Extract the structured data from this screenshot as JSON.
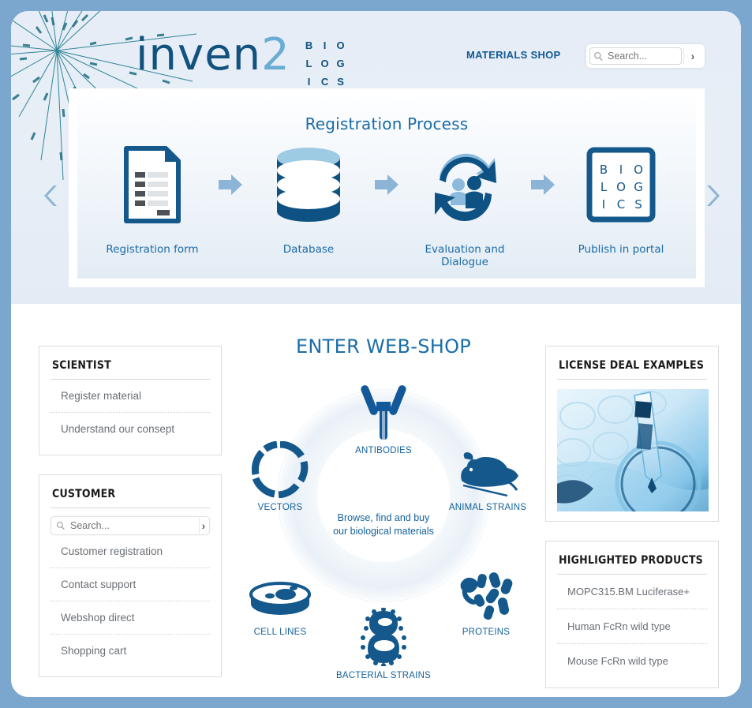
{
  "brand": {
    "word": "inven",
    "word_accent": "2",
    "grid": [
      "B",
      "I",
      "O",
      "L",
      "O",
      "G",
      "I",
      "C",
      "S"
    ]
  },
  "header": {
    "materials_shop": "MATERIALS SHOP",
    "search_placeholder": "Search...",
    "search_value": "",
    "search_icon": "search-icon",
    "go_icon": "chevron-right-icon"
  },
  "banner": {
    "title": "Registration Process",
    "prev_icon": "chevron-left-icon",
    "next_icon": "chevron-right-icon",
    "steps": [
      {
        "label": "Registration form",
        "icon": "document-icon"
      },
      {
        "label": "Database",
        "icon": "database-cylinder-icon"
      },
      {
        "label": "Evaluation and Dialogue",
        "icon": "dialogue-cycle-icon"
      },
      {
        "label": "Publish in portal",
        "icon": "biologics-box-icon"
      }
    ],
    "arrow_icon": "arrow-right-icon",
    "publish_grid": [
      "B",
      "I",
      "O",
      "L",
      "O",
      "G",
      "I",
      "C",
      "S"
    ]
  },
  "sidebar": {
    "scientist": {
      "heading": "SCIENTIST",
      "items": [
        "Register material",
        "Understand our consept"
      ]
    },
    "customer": {
      "heading": "CUSTOMER",
      "search_placeholder": "Search...",
      "search_value": "",
      "items": [
        "Customer registration",
        "Contact support",
        "Webshop direct",
        "Shopping cart"
      ]
    }
  },
  "webshop": {
    "title": "ENTER WEB-SHOP",
    "center_line1": "Browse, find and buy",
    "center_line2": "our biological materials",
    "nodes": [
      {
        "label": "ANTIBODIES",
        "icon": "antibody-icon"
      },
      {
        "label": "ANIMAL STRAINS",
        "icon": "mouse-icon"
      },
      {
        "label": "PROTEINS",
        "icon": "protein-ribbon-icon"
      },
      {
        "label": "BACTERIAL STRAINS",
        "icon": "bacteria-icon"
      },
      {
        "label": "CELL LINES",
        "icon": "petri-dish-icon"
      },
      {
        "label": "VECTORS",
        "icon": "plasmid-ring-icon"
      }
    ]
  },
  "right": {
    "license": {
      "heading": "LICENSE DEAL EXAMPLES",
      "image_alt": "pipette-over-beaker-photo"
    },
    "highlighted": {
      "heading": "HIGHLIGHTED PRODUCTS",
      "items": [
        "MOPC315.BM Luciferase+",
        "Human FcRn wild type",
        "Mouse FcRn wild type"
      ]
    }
  },
  "colors": {
    "frame": "#7ba7ce",
    "brand_dark": "#11527f",
    "brand_light": "#6aadd4",
    "link_blue": "#15629b",
    "header_bg": "#e6edf6",
    "icon_blue": "#1a5d8f",
    "arrow_blue": "#8fb4d4"
  }
}
